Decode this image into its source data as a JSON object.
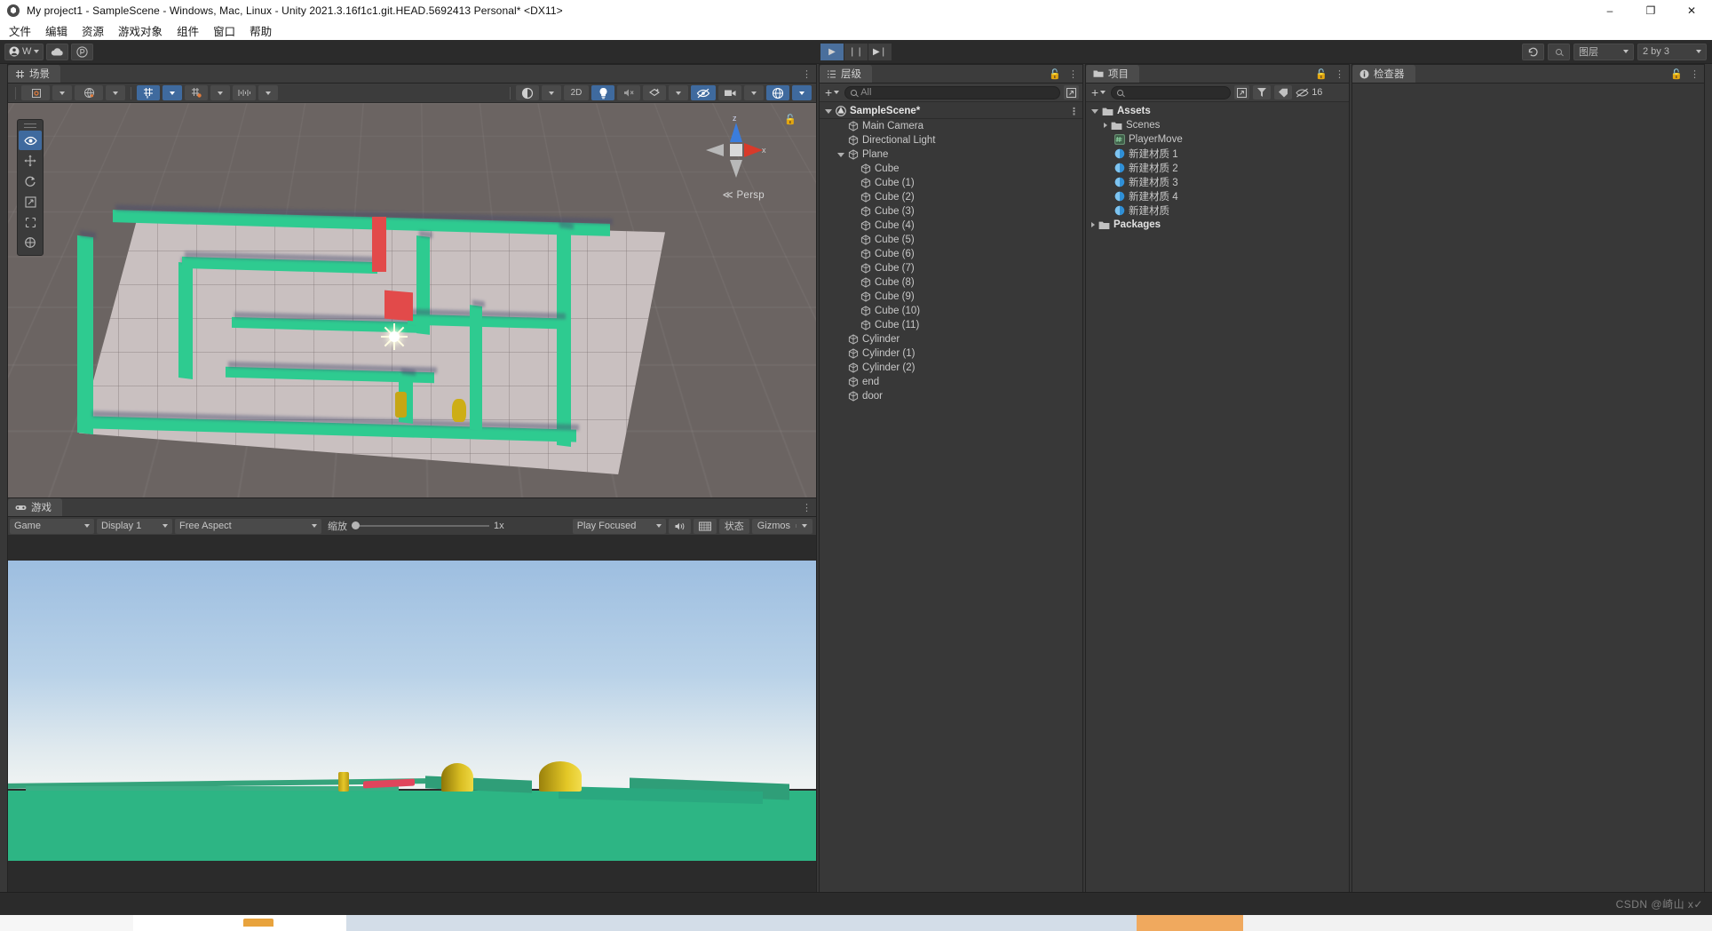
{
  "window": {
    "title": "My project1 - SampleScene - Windows, Mac, Linux - Unity 2021.3.16f1c1.git.HEAD.5692413 Personal* <DX11>",
    "minimize": "–",
    "maximize": "❐",
    "close": "✕"
  },
  "menubar": {
    "items": [
      {
        "label": "文件"
      },
      {
        "label": "编辑"
      },
      {
        "label": "资源"
      },
      {
        "label": "游戏对象"
      },
      {
        "label": "组件"
      },
      {
        "label": "窗口"
      },
      {
        "label": "帮助"
      }
    ]
  },
  "toolbar": {
    "account_label": "W",
    "cloud_icon": "cloud-icon",
    "collab_icon": "collab-icon",
    "play": "▶",
    "pause": "❘❘",
    "step": "▶❘",
    "undo_history_icon": "undo-history-icon",
    "search_icon": "search-icon",
    "layers_label": "图层",
    "layout_label": "2 by 3"
  },
  "scene_panel": {
    "tab_label": "场景",
    "tab_icon": "grid-icon",
    "toolbar": {
      "pivot_label": "pivot-icon",
      "handle_label": "global-icon",
      "grid_label": "grid-visibility-icon",
      "snap_label": "snap-icon",
      "increment_label": "snap-increment-icon",
      "shading_label": "shading-mode-icon",
      "mode_2d": "2D",
      "light_label": "scene-lighting-icon",
      "audio_label": "scene-audio-icon",
      "fx_label": "scene-fx-icon",
      "hidden_label": "scene-visibility-icon",
      "camera_label": "scene-camera-icon",
      "gizmos_label": "gizmos-icon"
    },
    "gizmo": {
      "axis_z": "z",
      "axis_x": "x",
      "projection": "Persp",
      "back_arrow": "≪"
    },
    "tools": [
      {
        "name": "view-tool",
        "glyph": "◉",
        "active": true
      },
      {
        "name": "move-tool",
        "glyph": "✛",
        "active": false
      },
      {
        "name": "rotate-tool",
        "glyph": "↻",
        "active": false
      },
      {
        "name": "scale-tool",
        "glyph": "↗",
        "active": false
      },
      {
        "name": "rect-tool",
        "glyph": "⬚",
        "active": false
      },
      {
        "name": "transform-tool",
        "glyph": "⨁",
        "active": false
      }
    ]
  },
  "game_panel": {
    "tab_label": "游戏",
    "tab_icon": "gamepad-icon",
    "target_display": "Game",
    "display": "Display 1",
    "aspect": "Free Aspect",
    "scale_label": "缩放",
    "scale_value": "1x",
    "play_mode": "Play Focused",
    "mute_icon": "mute-audio-icon",
    "stats_icon": "stats-icon",
    "stats_label": "状态",
    "gizmos_label": "Gizmos"
  },
  "hierarchy": {
    "tab_label": "层级",
    "tab_icon": "hierarchy-icon",
    "lock_icon": "lock-icon",
    "menu_icon": "kebab-menu-icon",
    "create_label": "+",
    "search_placeholder": "All",
    "items": [
      {
        "label": "SampleScene*",
        "depth": 0,
        "icon": "scene-icon",
        "expanded": true,
        "kebab": true
      },
      {
        "label": "Main Camera",
        "depth": 1,
        "icon": "gameobject-icon"
      },
      {
        "label": "Directional Light",
        "depth": 1,
        "icon": "gameobject-icon"
      },
      {
        "label": "Plane",
        "depth": 1,
        "icon": "gameobject-icon",
        "expanded": true
      },
      {
        "label": "Cube",
        "depth": 2,
        "icon": "gameobject-icon"
      },
      {
        "label": "Cube (1)",
        "depth": 2,
        "icon": "gameobject-icon"
      },
      {
        "label": "Cube (2)",
        "depth": 2,
        "icon": "gameobject-icon"
      },
      {
        "label": "Cube (3)",
        "depth": 2,
        "icon": "gameobject-icon"
      },
      {
        "label": "Cube (4)",
        "depth": 2,
        "icon": "gameobject-icon"
      },
      {
        "label": "Cube (5)",
        "depth": 2,
        "icon": "gameobject-icon"
      },
      {
        "label": "Cube (6)",
        "depth": 2,
        "icon": "gameobject-icon"
      },
      {
        "label": "Cube (7)",
        "depth": 2,
        "icon": "gameobject-icon"
      },
      {
        "label": "Cube (8)",
        "depth": 2,
        "icon": "gameobject-icon"
      },
      {
        "label": "Cube (9)",
        "depth": 2,
        "icon": "gameobject-icon"
      },
      {
        "label": "Cube (10)",
        "depth": 2,
        "icon": "gameobject-icon"
      },
      {
        "label": "Cube (11)",
        "depth": 2,
        "icon": "gameobject-icon"
      },
      {
        "label": "Cylinder",
        "depth": 1,
        "icon": "gameobject-icon"
      },
      {
        "label": "Cylinder (1)",
        "depth": 1,
        "icon": "gameobject-icon"
      },
      {
        "label": "Cylinder (2)",
        "depth": 1,
        "icon": "gameobject-icon"
      },
      {
        "label": "end",
        "depth": 1,
        "icon": "gameobject-icon"
      },
      {
        "label": "door",
        "depth": 1,
        "icon": "gameobject-icon"
      }
    ]
  },
  "project": {
    "tab_label": "项目",
    "tab_icon": "folder-icon",
    "lock_icon": "lock-icon",
    "menu_icon": "kebab-menu-icon",
    "create_label": "+",
    "search_placeholder": "",
    "hidden_count": "16",
    "items": [
      {
        "label": "Assets",
        "depth": 0,
        "icon": "folder-icon",
        "expanded": true,
        "bold": true
      },
      {
        "label": "Scenes",
        "depth": 1,
        "icon": "folder-icon",
        "collapsed": true
      },
      {
        "label": "PlayerMove",
        "depth": 1,
        "icon": "script-icon"
      },
      {
        "label": "新建材质 1",
        "depth": 1,
        "icon": "material-icon"
      },
      {
        "label": "新建材质 2",
        "depth": 1,
        "icon": "material-icon"
      },
      {
        "label": "新建材质 3",
        "depth": 1,
        "icon": "material-icon"
      },
      {
        "label": "新建材质 4",
        "depth": 1,
        "icon": "material-icon"
      },
      {
        "label": "新建材质",
        "depth": 1,
        "icon": "material-icon"
      },
      {
        "label": "Packages",
        "depth": 0,
        "icon": "folder-icon",
        "collapsed": true,
        "bold": true
      }
    ]
  },
  "inspector": {
    "tab_label": "检查器",
    "tab_icon": "info-icon",
    "lock_icon": "lock-icon",
    "menu_icon": "kebab-menu-icon"
  },
  "statusbar": {
    "watermark": "CSDN @崎山 x✓"
  },
  "colors": {
    "accent_blue": "#3f6a9e",
    "wall_green": "#2ecb90",
    "floor_gray": "#c9c0c0",
    "scene_bg": "#6b6462",
    "game_ground": "#2db584",
    "cylinder_gold": "#ccae18",
    "red_block": "#e24a4a",
    "panel_bg": "#383838"
  }
}
